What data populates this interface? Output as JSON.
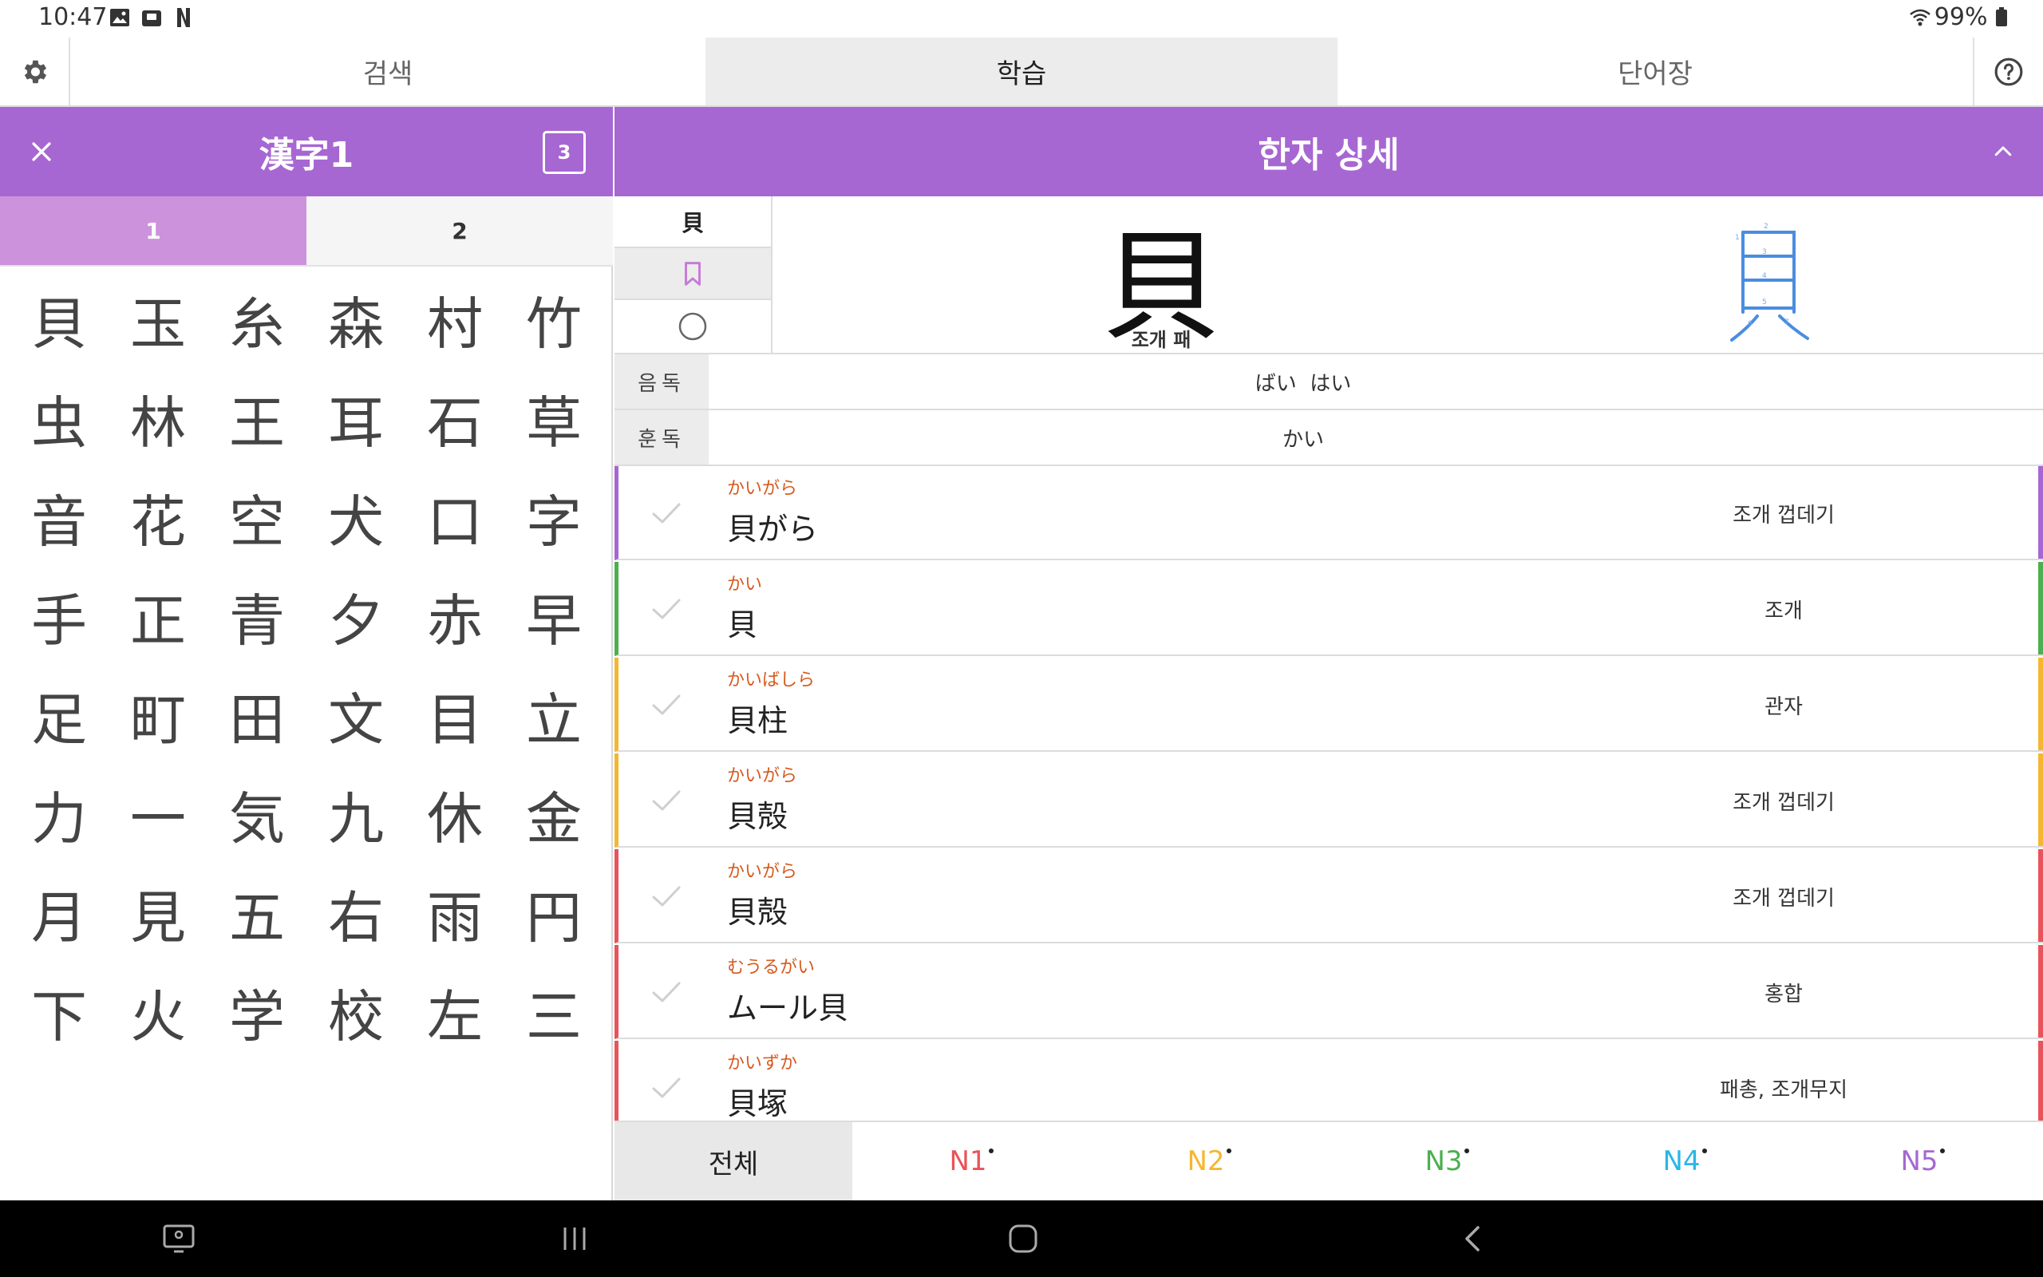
{
  "status_bar": {
    "time": "10:47",
    "battery": "99%"
  },
  "tabs": [
    {
      "label": "검색",
      "active": false
    },
    {
      "label": "학습",
      "active": true
    },
    {
      "label": "단어장",
      "active": false
    }
  ],
  "left_panel": {
    "title": "漢字1",
    "count": "3",
    "sub_tabs": [
      {
        "label": "1",
        "active": true
      },
      {
        "label": "2",
        "active": false
      }
    ],
    "kanji": [
      "貝",
      "玉",
      "糸",
      "森",
      "村",
      "竹",
      "虫",
      "林",
      "王",
      "耳",
      "石",
      "草",
      "音",
      "花",
      "空",
      "犬",
      "口",
      "字",
      "手",
      "正",
      "青",
      "夕",
      "赤",
      "早",
      "足",
      "町",
      "田",
      "文",
      "目",
      "立",
      "力",
      "一",
      "気",
      "九",
      "休",
      "金",
      "月",
      "見",
      "五",
      "右",
      "雨",
      "円",
      "下",
      "火",
      "学",
      "校",
      "左",
      "三"
    ]
  },
  "detail": {
    "title": "한자 상세",
    "kanji": "貝",
    "meaning": "조개 패",
    "onyomi_label": "음독",
    "onyomi": "ばい  はい",
    "kunyomi_label": "훈독",
    "kunyomi": "かい"
  },
  "words": [
    {
      "reading": "かいがら",
      "word": "貝がら",
      "meaning": "조개 껍데기",
      "color": "#a767d2"
    },
    {
      "reading": "かい",
      "word": "貝",
      "meaning": "조개",
      "color": "#4caf50"
    },
    {
      "reading": "かいばしら",
      "word": "貝柱",
      "meaning": "관자",
      "color": "#f5b731"
    },
    {
      "reading": "かいがら",
      "word": "貝殻",
      "meaning": "조개 껍데기",
      "color": "#f5b731"
    },
    {
      "reading": "かいがら",
      "word": "貝殻",
      "meaning": "조개 껍데기",
      "color": "#e9535a"
    },
    {
      "reading": "むうるがい",
      "word": "ムール貝",
      "meaning": "홍합",
      "color": "#e9535a"
    },
    {
      "reading": "かいずか",
      "word": "貝塚",
      "meaning": "패총, 조개무지",
      "color": "#e9535a"
    }
  ],
  "levels": [
    {
      "label": "전체",
      "color": "#222222",
      "active": true
    },
    {
      "label": "N1",
      "color": "#e9535a",
      "active": false
    },
    {
      "label": "N2",
      "color": "#f5b731",
      "active": false
    },
    {
      "label": "N3",
      "color": "#4caf50",
      "active": false
    },
    {
      "label": "N4",
      "color": "#29b6e6",
      "active": false
    },
    {
      "label": "N5",
      "color": "#a767d2",
      "active": false
    }
  ],
  "colors": {
    "accent": "#a767d2",
    "accent_light": "#cc92dc",
    "reading": "#d65a1f"
  }
}
